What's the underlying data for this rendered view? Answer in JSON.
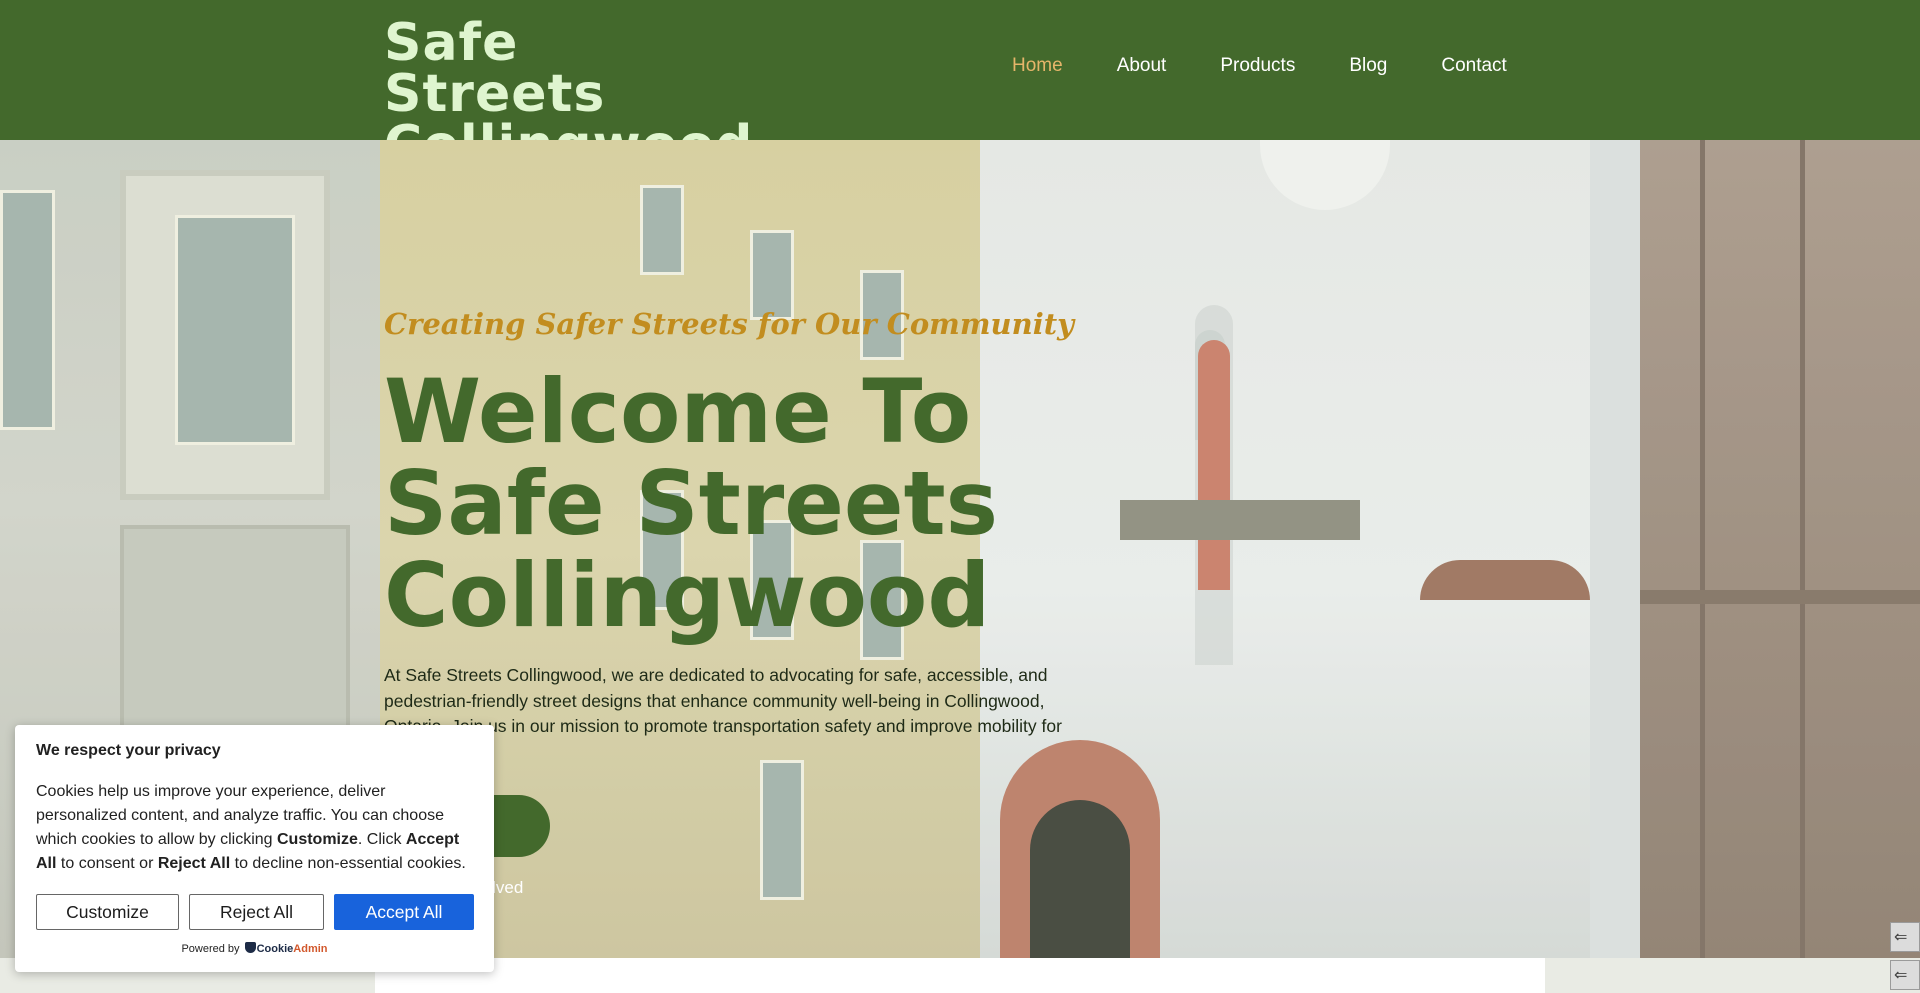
{
  "header": {
    "brand_line1": "Safe Streets",
    "brand_line2": "Collingwood",
    "nav": [
      {
        "label": "Home",
        "active": true
      },
      {
        "label": "About",
        "active": false
      },
      {
        "label": "Products",
        "active": false
      },
      {
        "label": "Blog",
        "active": false
      },
      {
        "label": "Contact",
        "active": false
      }
    ]
  },
  "hero": {
    "tagline": "Creating Safer Streets for Our Community",
    "title": "Welcome To Safe Streets Collingwood",
    "text": "At Safe Streets Collingwood, we are dedicated to advocating for safe, accessible, and pedestrian-friendly street designs that enhance community well-being in Collingwood, Ontario. Join us in our mission to promote transportation safety and improve mobility for",
    "cta_label": "Get Involved"
  },
  "cookie_banner": {
    "title": "We respect your privacy",
    "text_part1": "Cookies help us improve your experience, deliver personalized content, and analyze traffic. You can choose which cookies to allow by clicking ",
    "text_customize": "Customize",
    "text_part2": ". Click ",
    "text_accept": "Accept All",
    "text_part3": " to consent or ",
    "text_reject": "Reject All",
    "text_part4": " to decline non-essential cookies.",
    "customize_label": "Customize",
    "reject_label": "Reject All",
    "accept_label": "Accept All",
    "powered_by": "Powered by",
    "powered_logo_a": "Cookie",
    "powered_logo_b": "Admin"
  },
  "edge_buttons": {
    "first": "⇐",
    "second": "⇐"
  },
  "colors": {
    "header_bg": "#43692c",
    "brand": "#dff5cf",
    "nav_active": "#e5b56a",
    "tagline": "#c28d1f",
    "accent_blue": "#1863dc"
  }
}
